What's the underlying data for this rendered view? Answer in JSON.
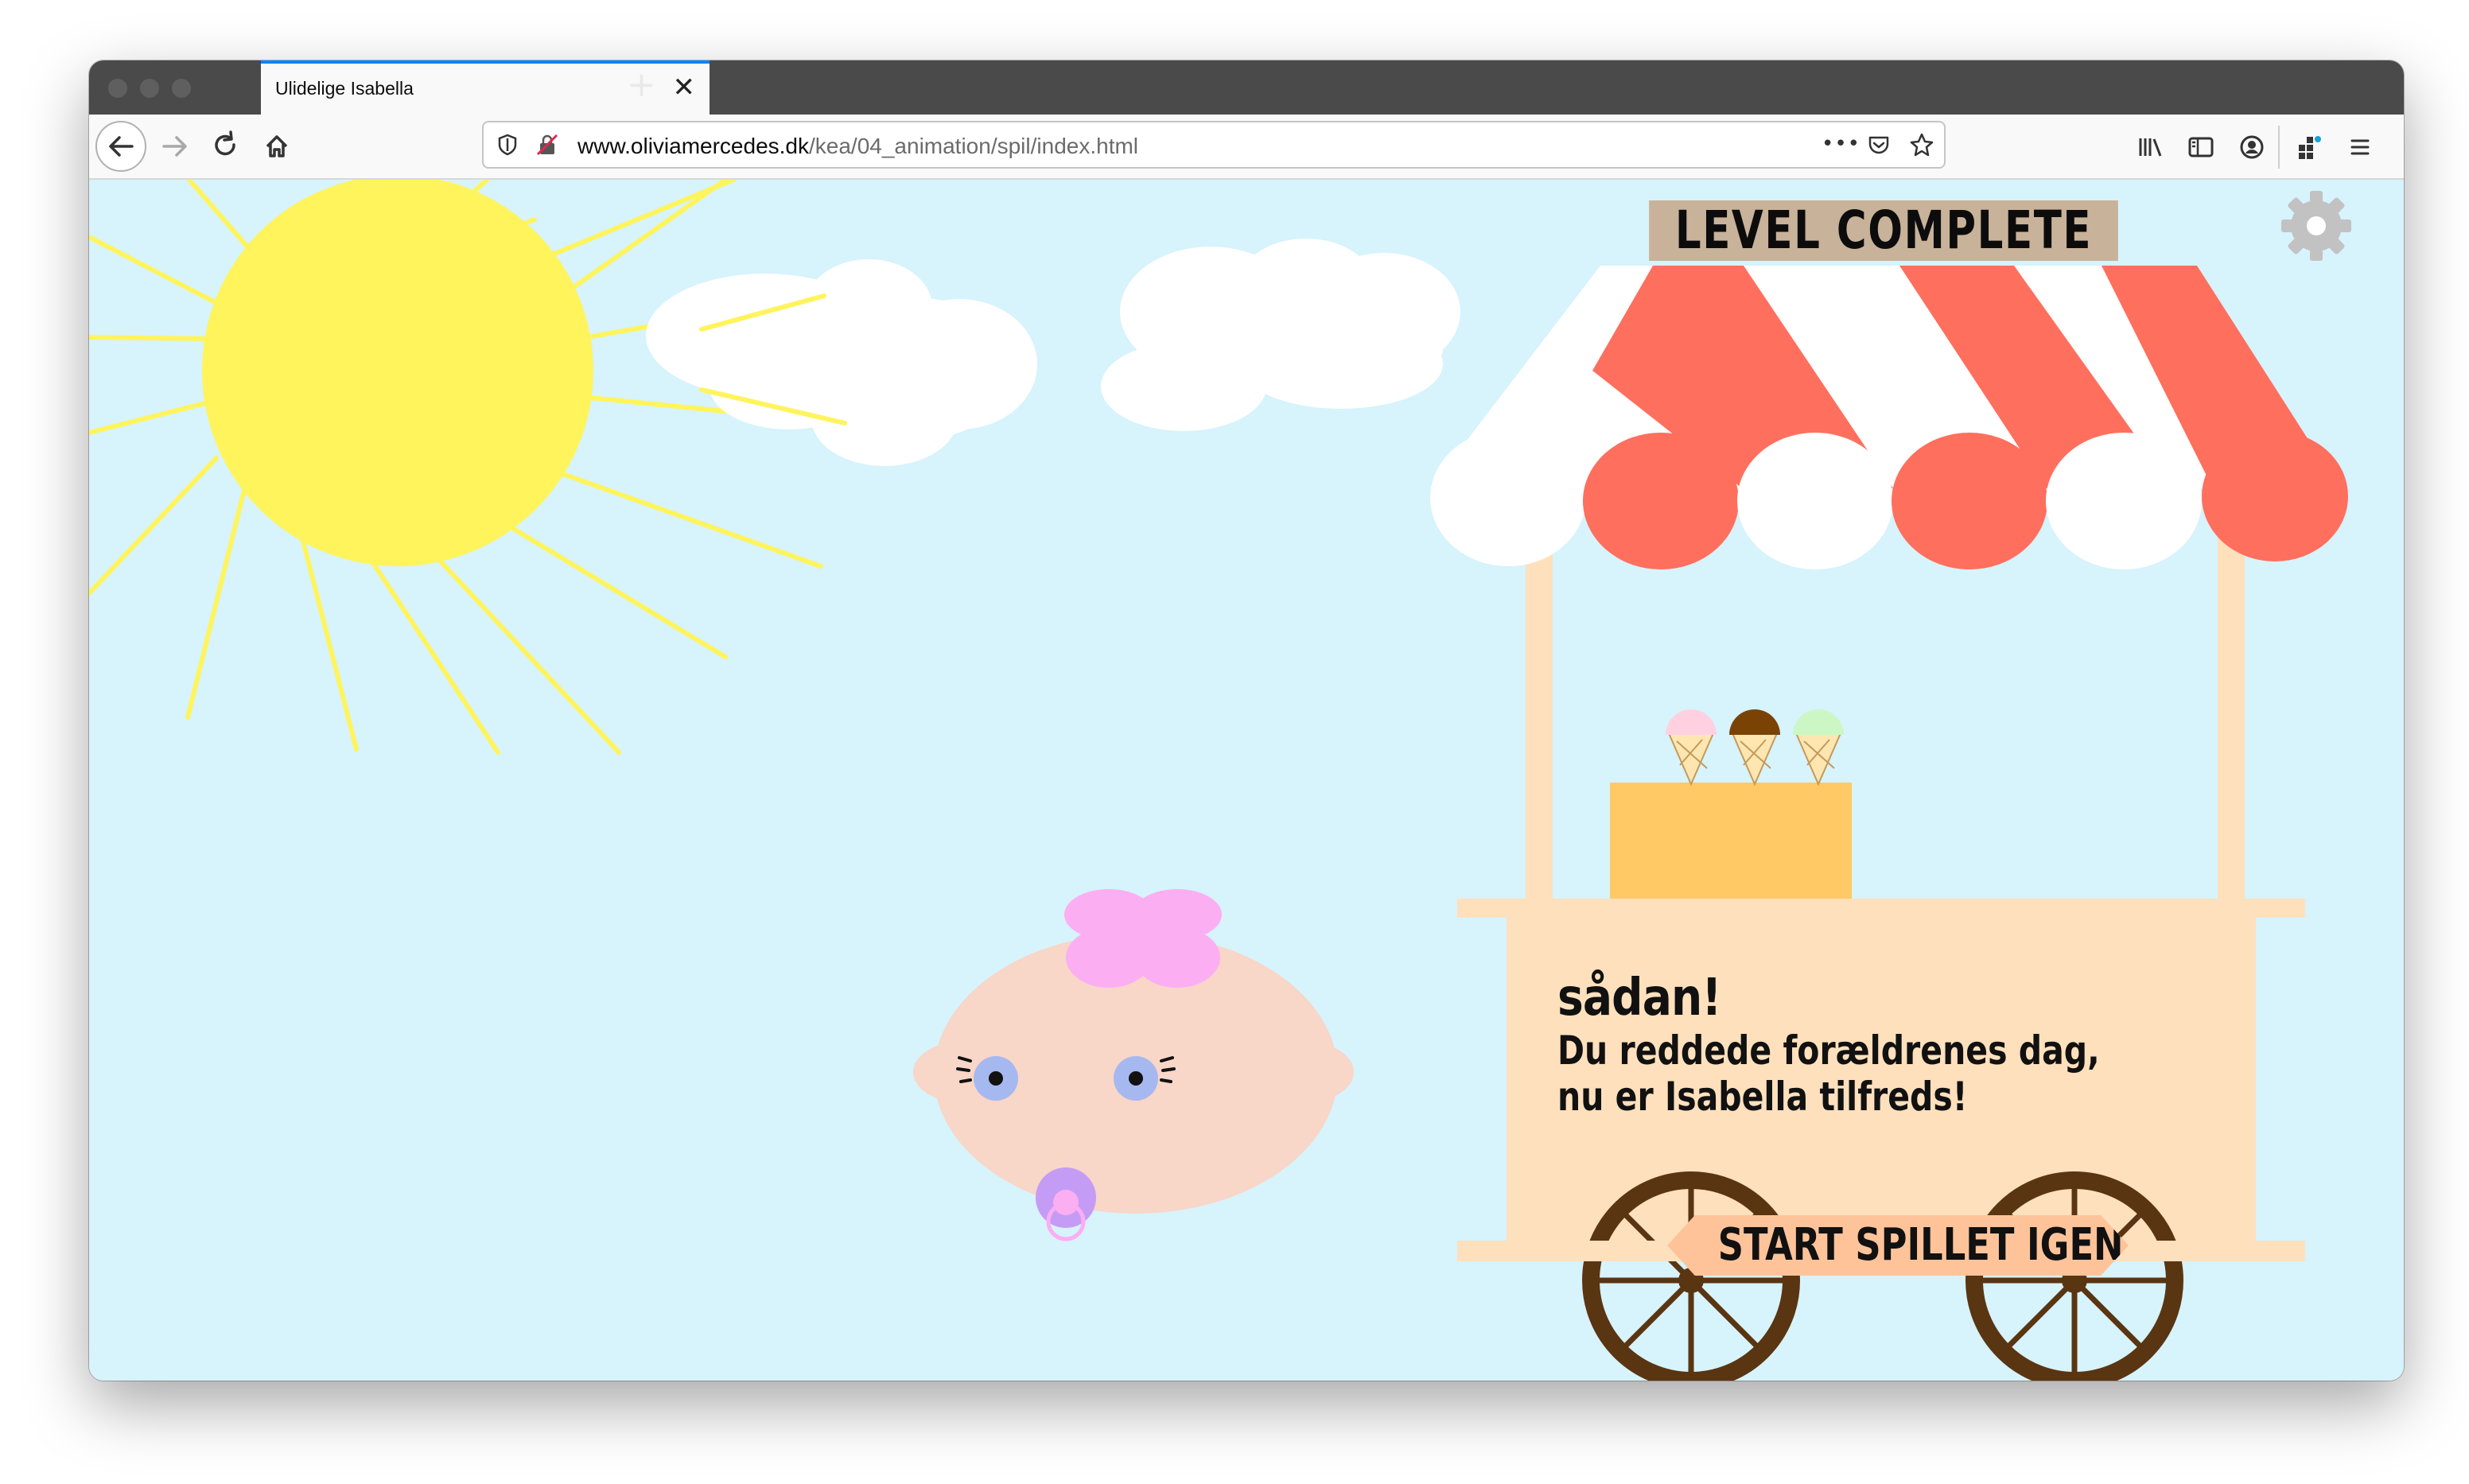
{
  "browser": {
    "tab_title": "Ulidelige Isabella",
    "tab_close": "✕",
    "new_tab": "+",
    "url_host": "www.oliviamercedes.dk",
    "url_path": "/kea/04_animation/spil/index.html",
    "url_more": "•••",
    "toolbar_icons": [
      "back-icon",
      "forward-icon",
      "reload-icon",
      "home-icon",
      "library-icon",
      "sidebar-icon",
      "account-icon",
      "extensions-icon",
      "menu-icon"
    ]
  },
  "game": {
    "level_status": "LEVEL COMPLETE",
    "message_heading": "sådan!",
    "message_line1": "Du reddede forældrenes dag,",
    "message_line2": "nu er Isabella tilfreds!",
    "restart_label": "START SPILLET IGEN",
    "settings_icon": "gear-icon"
  },
  "colors": {
    "sky": "#d7f3fc",
    "sun": "#fff45c",
    "awning_red": "#ff6f5e",
    "cart": "#ffe0bd",
    "cart_box": "#ffc966",
    "button": "#ffc39a",
    "wheel": "#5a3512",
    "face": "#f8d6c8",
    "bow": "#fcaef3",
    "pacifier": "#c59cf5",
    "eyes": "#a6b8f0"
  }
}
